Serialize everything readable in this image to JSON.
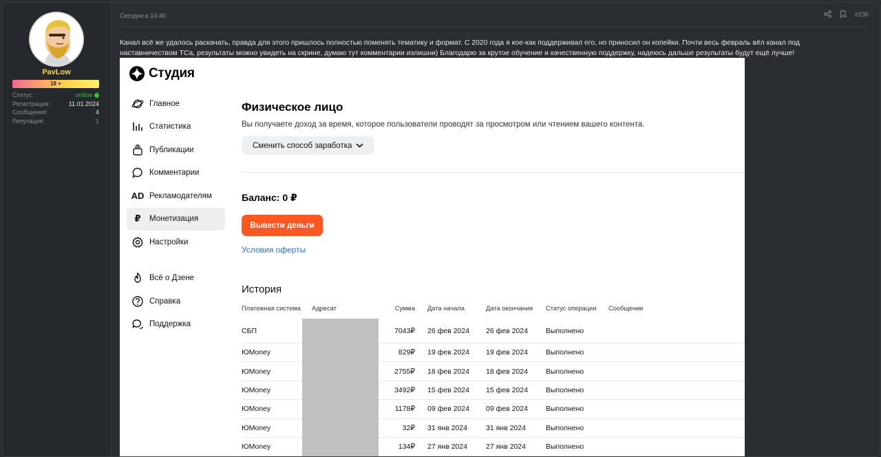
{
  "user": {
    "name": "PavLow",
    "age_badge": "18 +",
    "stats": [
      {
        "label": "Статус:",
        "value": "online",
        "type": "online"
      },
      {
        "label": "Регистрация:",
        "value": "11.01.2024",
        "type": "plain"
      },
      {
        "label": "Сообщения:",
        "value": "4",
        "type": "plain"
      },
      {
        "label": "Репутация:",
        "value": "1",
        "type": "green"
      }
    ]
  },
  "post": {
    "time": "Сегодня в 14:49",
    "number": "#236",
    "icons": [
      "share-icon",
      "bookmark-icon"
    ],
    "message": "Канал всё же удалось раскачать, правда для этого пришлось полностью поменять тематику и формат. С 2020 года я кое-как поддерживал его, но приносил он копейки. Почти весь февраль вёл канал под наставничеством ТСа, результаты можно увидеть на скрине, думаю тут комментарии излишни) Благодарю за крутое обучение и качественную поддержку, надеюсь дальше результаты будут ещё лучше!"
  },
  "studio": {
    "logo": "Студия",
    "nav": [
      {
        "label": "Главное",
        "icon": "planet-icon",
        "active": false
      },
      {
        "label": "Статистика",
        "icon": "bar-chart-icon",
        "active": false
      },
      {
        "label": "Публикации",
        "icon": "publications-icon",
        "active": false
      },
      {
        "label": "Комментарии",
        "icon": "comment-icon",
        "active": false
      },
      {
        "label": "Рекламодателям",
        "icon": "ad-icon",
        "active": false
      },
      {
        "label": "Монетизация",
        "icon": "ruble-icon",
        "active": true
      },
      {
        "label": "Настройки",
        "icon": "gear-icon",
        "active": false
      }
    ],
    "nav_secondary": [
      {
        "label": "Всё о Дзене",
        "icon": "flame-icon"
      },
      {
        "label": "Справка",
        "icon": "help-icon"
      },
      {
        "label": "Поддержка",
        "icon": "support-icon"
      }
    ],
    "title": "Физическое лицо",
    "subtitle": "Вы получаете доход за время, которое пользователи проводят за просмотром или чтением вашего контента.",
    "change_button": "Сменить способ заработка",
    "balance": "Баланс: 0 ₽",
    "withdraw_button": "Вывести деньги",
    "offer_link": "Условия оферты",
    "history_title": "История",
    "table": {
      "headers": [
        "Платежная система",
        "Адресат",
        "Сумма",
        "Дата начала",
        "Дата окончания",
        "Статус операции",
        "Сообщение"
      ],
      "rows": [
        [
          "СБП",
          "",
          "7043₽",
          "26 фев 2024",
          "26 фев 2024",
          "Выполнено",
          ""
        ],
        [
          "ЮMoney",
          "",
          "829₽",
          "19 фев 2024",
          "19 фев 2024",
          "Выполнено",
          ""
        ],
        [
          "ЮMoney",
          "",
          "2755₽",
          "18 фев 2024",
          "18 фев 2024",
          "Выполнено",
          ""
        ],
        [
          "ЮMoney",
          "",
          "3492₽",
          "15 фев 2024",
          "15 фев 2024",
          "Выполнено",
          ""
        ],
        [
          "ЮMoney",
          "",
          "1178₽",
          "09 фев 2024",
          "09 фев 2024",
          "Выполнено",
          ""
        ],
        [
          "ЮMoney",
          "",
          "32₽",
          "31 янв 2024",
          "31 янв 2024",
          "Выполнено",
          ""
        ],
        [
          "ЮMoney",
          "",
          "134₽",
          "27 янв 2024",
          "27 янв 2024",
          "Выполнено",
          ""
        ]
      ]
    }
  },
  "colors": {
    "page_bg": "#2a2d31",
    "username": "#ffd54a",
    "online": "#3dbb3d",
    "accent_orange": "#fe5722",
    "link_blue": "#2d74c4"
  }
}
